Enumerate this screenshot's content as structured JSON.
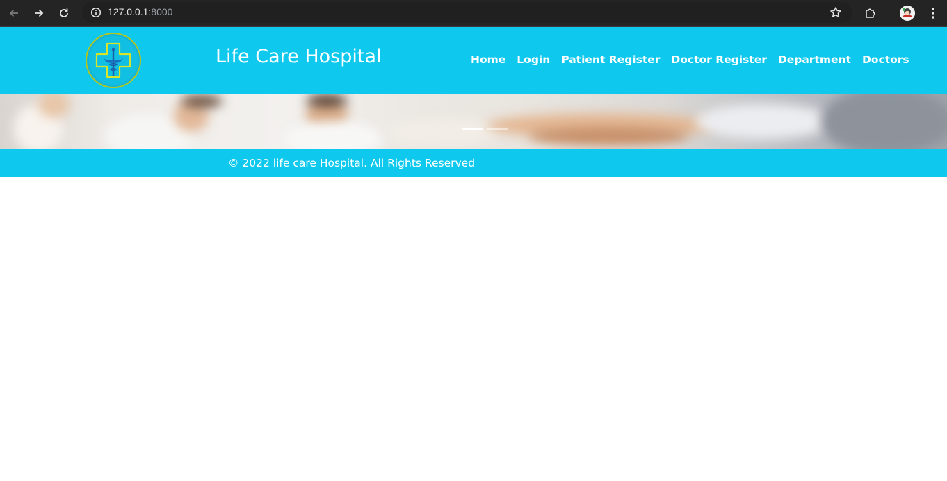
{
  "browser": {
    "url_host": "127.0.0.1",
    "url_port": ":8000",
    "icons": {
      "back": "arrow-left-icon",
      "forward": "arrow-right-icon",
      "reload": "reload-icon",
      "site_info": "info-icon",
      "bookmark": "star-icon",
      "extensions": "puzzle-icon",
      "menu": "kebab-menu-icon"
    }
  },
  "site": {
    "title": "Life Care Hospital",
    "logo": "hospital-cross-caduceus-logo",
    "nav": [
      {
        "label": "Home"
      },
      {
        "label": "Login"
      },
      {
        "label": "Patient Register"
      },
      {
        "label": "Doctor Register"
      },
      {
        "label": "Department"
      },
      {
        "label": "Doctors"
      }
    ],
    "carousel": {
      "slides": 2,
      "active": 1
    },
    "footer": "© 2022 life care Hospital. All Rights Reserved"
  },
  "colors": {
    "brand": "#0ec8ee",
    "chrome_bg": "#242424"
  }
}
